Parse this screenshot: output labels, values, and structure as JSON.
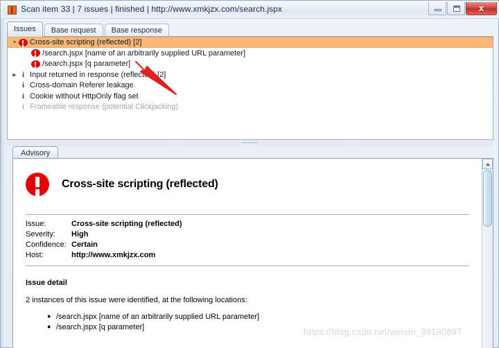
{
  "window": {
    "title": "Scan item 33 | 7 issues | finished | http://www.xmkjzx.com/search.jspx",
    "app_icon": "burp-suite-icon",
    "controls": {
      "minimize": "minimize-icon",
      "maximize": "maximize-icon",
      "close_label": "x"
    }
  },
  "tabs": [
    {
      "label": "Issues",
      "active": true
    },
    {
      "label": "Base request",
      "active": false
    },
    {
      "label": "Base response",
      "active": false
    }
  ],
  "issues_tree": [
    {
      "label": "Cross-site scripting (reflected) [2]",
      "icon": "error-icon",
      "twisty": "expanded",
      "indent": 0,
      "selected": true,
      "dim": false
    },
    {
      "label": "/search.jspx [name of an arbitrarily supplied URL parameter]",
      "icon": "error-icon",
      "twisty": "none",
      "indent": 1,
      "selected": false,
      "dim": false
    },
    {
      "label": "/search.jspx [q parameter]",
      "icon": "error-icon",
      "twisty": "none",
      "indent": 1,
      "selected": false,
      "dim": false
    },
    {
      "label": "Input returned in response (reflected) [2]",
      "icon": "info-icon",
      "twisty": "collapsed",
      "indent": 0,
      "selected": false,
      "dim": false
    },
    {
      "label": "Cross-domain Referer leakage",
      "icon": "info-icon",
      "twisty": "none",
      "indent": 0,
      "selected": false,
      "dim": false
    },
    {
      "label": "Cookie without HttpOnly flag set",
      "icon": "info-icon",
      "twisty": "none",
      "indent": 0,
      "selected": false,
      "dim": false
    },
    {
      "label": "Frameable response (potential Clickjacking)",
      "icon": "info-icon",
      "twisty": "none",
      "indent": 0,
      "selected": false,
      "dim": true
    }
  ],
  "advisory": {
    "tab_label": "Advisory",
    "heading": "Cross-site scripting (reflected)",
    "heading_icon": "error-icon-large",
    "meta": [
      {
        "key": "Issue:",
        "value": "Cross-site scripting (reflected)"
      },
      {
        "key": "Severity:",
        "value": "High"
      },
      {
        "key": "Confidence:",
        "value": "Certain"
      },
      {
        "key": "Host:",
        "value": "http://www.xmkjzx.com"
      }
    ],
    "detail_title": "Issue detail",
    "detail_intro": "2 instances of this issue were identified, at the following locations:",
    "detail_locations": [
      "/search.jspx [name of an arbitrarily supplied URL parameter]",
      "/search.jspx [q parameter]"
    ]
  },
  "watermark": "https://blog.csdn.net/weixin_39190897",
  "colors": {
    "selection_orange": "#fbb878",
    "error_red": "#e00000",
    "annotation_red": "#e02020",
    "title_text": "#14304f"
  }
}
